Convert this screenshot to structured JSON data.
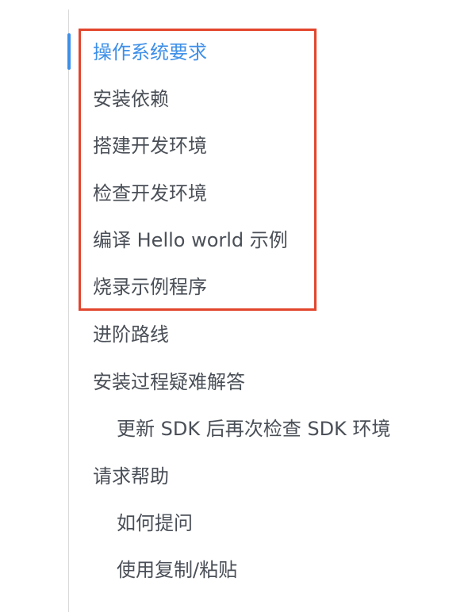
{
  "toc": {
    "items": [
      {
        "label": "操作系统要求"
      },
      {
        "label": "安装依赖"
      },
      {
        "label": "搭建开发环境"
      },
      {
        "label": "检查开发环境"
      },
      {
        "label": "编译 Hello world 示例"
      },
      {
        "label": "烧录示例程序"
      },
      {
        "label": "进阶路线"
      },
      {
        "label": "安装过程疑难解答"
      },
      {
        "label": "更新 SDK 后再次检查 SDK 环境"
      },
      {
        "label": "请求帮助"
      },
      {
        "label": "如何提问"
      },
      {
        "label": "使用复制/粘贴"
      }
    ],
    "active_index": 0
  },
  "colors": {
    "active_text": "#3d8fe8",
    "normal_text": "#4a4f57",
    "active_indicator": "#3d8fe8",
    "highlight_border": "#e2452c",
    "rail": "#d9d9d9"
  }
}
